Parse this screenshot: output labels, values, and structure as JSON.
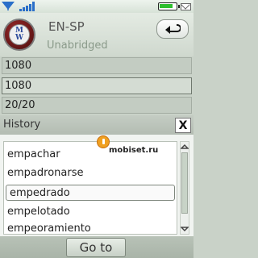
{
  "app": {
    "dictionary_name": "EN-SP",
    "edition": "Unabridged",
    "logo_text": [
      "M",
      "W"
    ]
  },
  "fields": {
    "search_field": "1080",
    "entry_field": "1080",
    "result_count": "20/20"
  },
  "history": {
    "title": "History",
    "close_label": "X",
    "selected_item": "empedrado",
    "items": [
      "empachar",
      "empadronarse",
      "empedrado",
      "empelotado",
      "empeoramiento"
    ]
  },
  "watermark": "mobiset.ru",
  "footer": {
    "goto_label": "Go to"
  },
  "status": {
    "battery_level": 0.85
  },
  "colors": {
    "background": "#c9d2c8",
    "panel": "#f1f4f1",
    "battery": "#2fbf2f",
    "logo": "#7a1a1a"
  },
  "icons": {
    "signal_left": "signal-icon",
    "signal_right": "network-bars-icon",
    "battery": "battery-icon",
    "message": "envelope-icon",
    "back": "back-arrow-icon",
    "close": "close-icon"
  }
}
